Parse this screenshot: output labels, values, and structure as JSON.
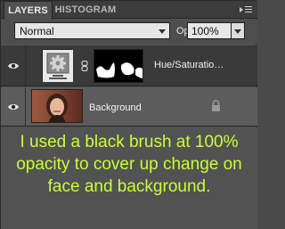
{
  "tabs": [
    {
      "label": "LAYERS"
    },
    {
      "label": "HISTOGRAM"
    }
  ],
  "options": {
    "blend_mode": "Normal",
    "opacity_label": "Opacity:",
    "opacity_value": "100%"
  },
  "layers": [
    {
      "name": "Hue/Saturatio…",
      "visible": true,
      "type": "adjustment",
      "icon": "hue-saturation-adjustment-icon"
    },
    {
      "name": "Background",
      "visible": true,
      "type": "image",
      "locked": true
    }
  ],
  "caption": "I used a black brush at 100% opacity to cover up change on face and background.",
  "colors": {
    "caption_text": "#c8ff35",
    "panel_bg": "#505050",
    "selected_layer_bg": "#3a3a3a"
  }
}
